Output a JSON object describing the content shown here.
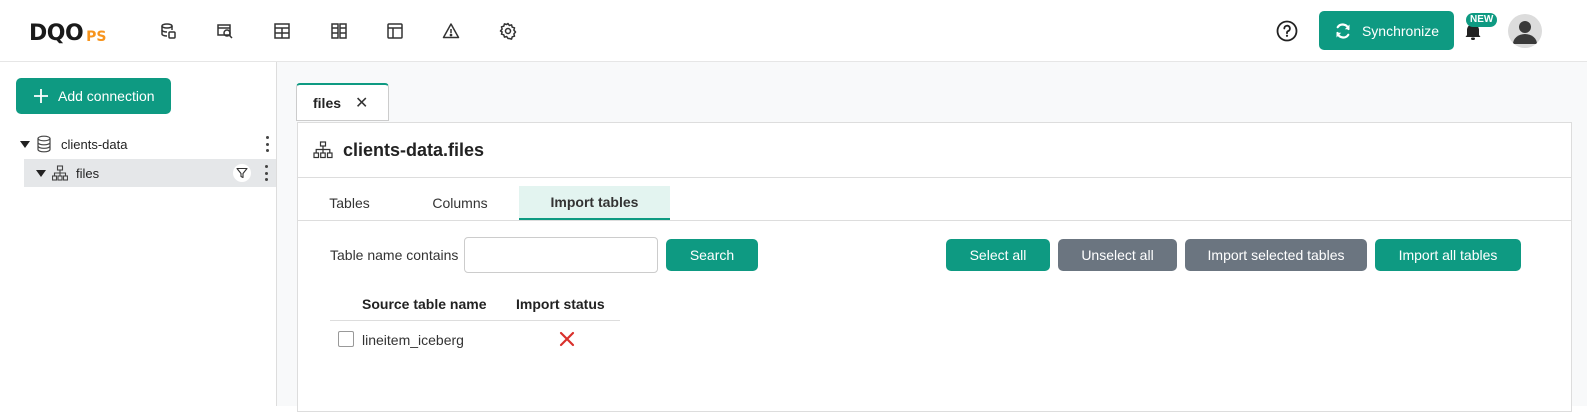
{
  "header": {
    "logo_main": "DQO",
    "logo_suffix": "PS",
    "nav_icons": [
      "data-sources-icon",
      "profiling-icon",
      "monitoring-checks-icon",
      "partition-checks-icon",
      "dashboards-icon",
      "incidents-icon",
      "settings-icon"
    ],
    "sync_label": "Synchronize",
    "new_badge": "NEW"
  },
  "sidebar": {
    "add_connection_label": "Add connection",
    "tree": [
      {
        "label": "clients-data",
        "icon": "database-icon"
      },
      {
        "label": "files",
        "icon": "schema-icon",
        "selected": true
      }
    ]
  },
  "main": {
    "tab_label": "files",
    "panel_title": "clients-data.files",
    "subtabs": [
      "Tables",
      "Columns",
      "Import tables"
    ],
    "active_subtab": "Import tables",
    "filter_label": "Table name contains",
    "filter_value": "",
    "search_label": "Search",
    "select_all_label": "Select all",
    "unselect_all_label": "Unselect all",
    "import_selected_label": "Import selected tables",
    "import_all_label": "Import all tables",
    "columns": [
      "Source table name",
      "Import status"
    ],
    "rows": [
      {
        "name": "lineitem_iceberg",
        "status": "not-imported"
      }
    ]
  },
  "colors": {
    "accent": "#0e9a82",
    "secondary_button": "#6b7580",
    "error": "#d9302c",
    "logo_orange": "#f7941d"
  }
}
